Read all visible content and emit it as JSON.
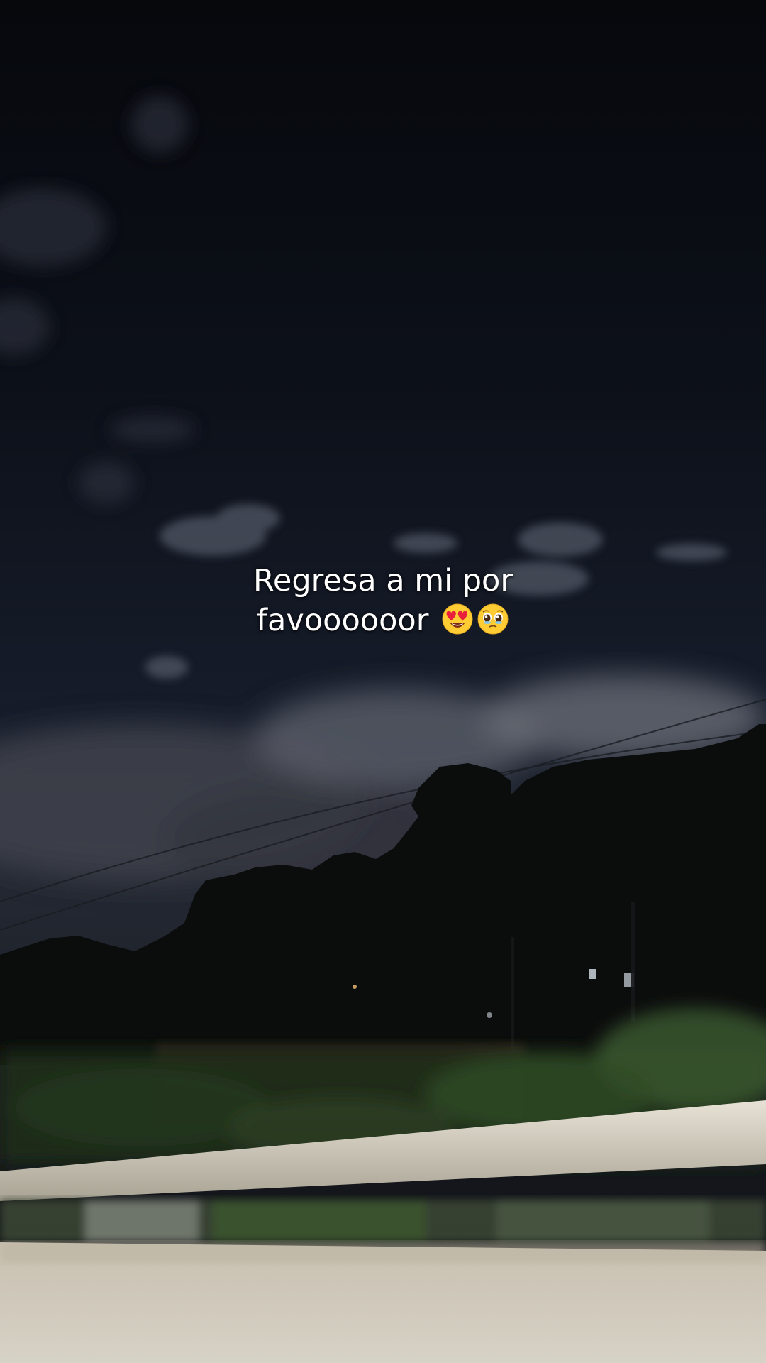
{
  "caption": {
    "line1": "Regresa a mi por",
    "line2": "favoooooor",
    "emoji_1": "smiling-face-with-heart-eyes",
    "emoji_2": "face-holding-back-tears"
  },
  "colors": {
    "sky_top": "#07090d",
    "sky_mid": "#1a2030",
    "cloud": "#6f7481",
    "trees": "#0b0d0d",
    "grass": "#34502a",
    "guardrail": "#d9d3c6",
    "text": "#ffffff"
  }
}
